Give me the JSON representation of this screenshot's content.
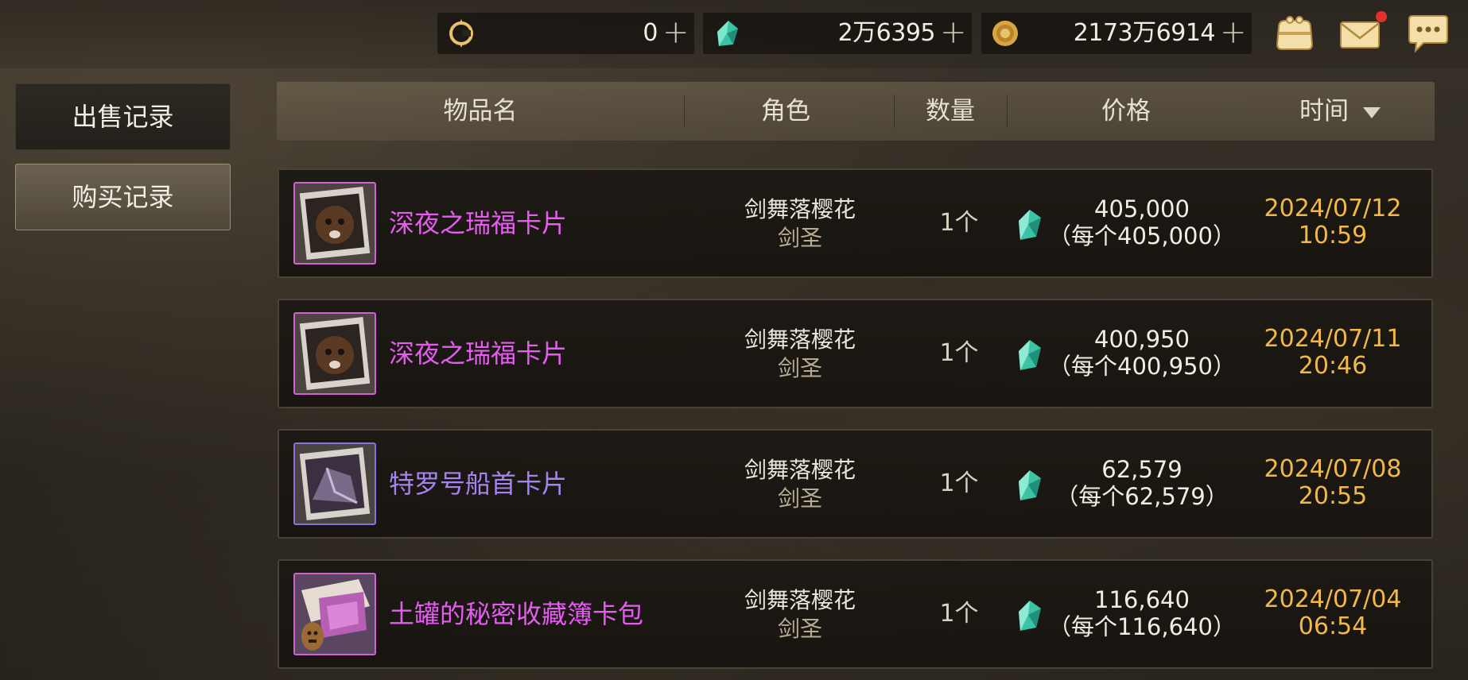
{
  "currencies": [
    {
      "name": "c-coin-icon",
      "value": "0",
      "plus": "+"
    },
    {
      "name": "gem-icon",
      "value": "2万6395",
      "plus": "+"
    },
    {
      "name": "gold-coin-icon",
      "value": "2173万6914",
      "plus": "+"
    }
  ],
  "top_icons": [
    "wallet-icon",
    "mail-icon",
    "chat-icon"
  ],
  "tabs": {
    "sell": "出售记录",
    "buy": "购买记录"
  },
  "columns": {
    "name": "物品名",
    "role": "角色",
    "qty": "数量",
    "price": "价格",
    "time": "时间"
  },
  "rows": [
    {
      "item": "深夜之瑞福卡片",
      "item_color": "#e45cf0",
      "role": "剑舞落樱花",
      "class": "剑圣",
      "qty": "1个",
      "price": "405,000",
      "unit": "（每个405,000）",
      "date": "2024/07/12",
      "clock": "10:59",
      "thumb": "bear-card"
    },
    {
      "item": "深夜之瑞福卡片",
      "item_color": "#e45cf0",
      "role": "剑舞落樱花",
      "class": "剑圣",
      "qty": "1个",
      "price": "400,950",
      "unit": "（每个400,950）",
      "date": "2024/07/11",
      "clock": "20:46",
      "thumb": "bear-card"
    },
    {
      "item": "特罗号船首卡片",
      "item_color": "#a684f0",
      "role": "剑舞落樱花",
      "class": "剑圣",
      "qty": "1个",
      "price": "62,579",
      "unit": "（每个62,579）",
      "date": "2024/07/08",
      "clock": "20:55",
      "thumb": "ship-card"
    },
    {
      "item": "土罐的秘密收藏簿卡包",
      "item_color": "#e45cf0",
      "role": "剑舞落樱花",
      "class": "剑圣",
      "qty": "1个",
      "price": "116,640",
      "unit": "（每个116,640）",
      "date": "2024/07/04",
      "clock": "06:54",
      "thumb": "card-pack"
    }
  ],
  "colors": {
    "legendary": "#e45cf0",
    "epic": "#a684f0",
    "time": "#f1b84a"
  }
}
